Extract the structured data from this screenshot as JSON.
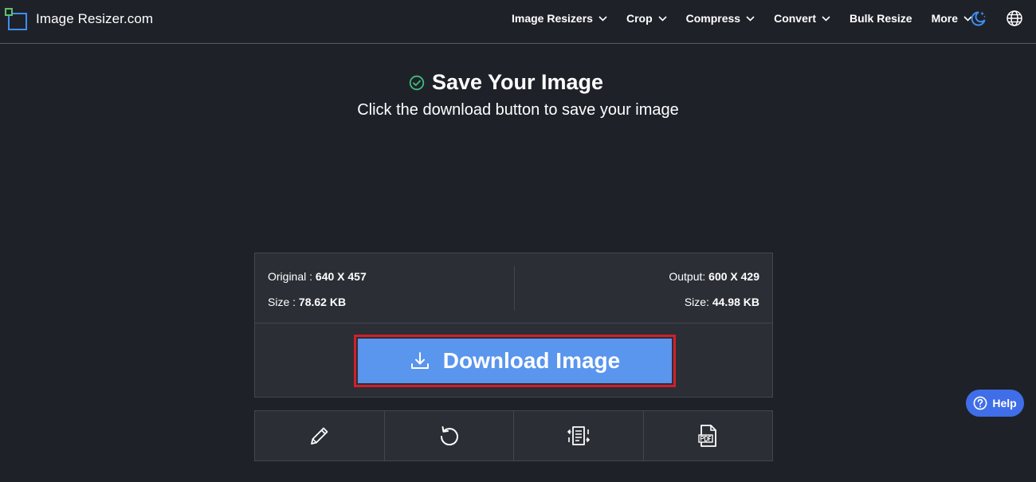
{
  "brand": {
    "name": "Image Resizer.com"
  },
  "nav": {
    "items": [
      {
        "label": "Image Resizers",
        "has_caret": true
      },
      {
        "label": "Crop",
        "has_caret": true
      },
      {
        "label": "Compress",
        "has_caret": true
      },
      {
        "label": "Convert",
        "has_caret": true
      },
      {
        "label": "Bulk Resize",
        "has_caret": false
      },
      {
        "label": "More",
        "has_caret": true
      }
    ],
    "icons": [
      "theme-toggle-icon",
      "globe-icon"
    ]
  },
  "heading": {
    "title": "Save Your Image",
    "subtitle": "Click the download button to save your image",
    "icon": "check-circle-icon"
  },
  "info": {
    "original_label": "Original : ",
    "original_value": "640 X 457",
    "original_size_label": "Size : ",
    "original_size_value": "78.62 KB",
    "output_label": "Output: ",
    "output_value": "600 X 429",
    "output_size_label": "Size: ",
    "output_size_value": "44.98 KB"
  },
  "download": {
    "label": "Download Image",
    "icon": "download-icon"
  },
  "tools": [
    "edit-pencil-icon",
    "undo-icon",
    "compress-document-icon",
    "pdf-file-icon"
  ],
  "help": {
    "label": "Help"
  },
  "colors": {
    "background": "#1f2129",
    "card": "#2c2e36",
    "download_button": "#5a95ee",
    "highlight_border": "#d21f2c",
    "help_button": "#3f6ee8",
    "check": "#3dbd7d",
    "logo_blue": "#3d8ef0",
    "logo_green": "#5ec26a"
  }
}
